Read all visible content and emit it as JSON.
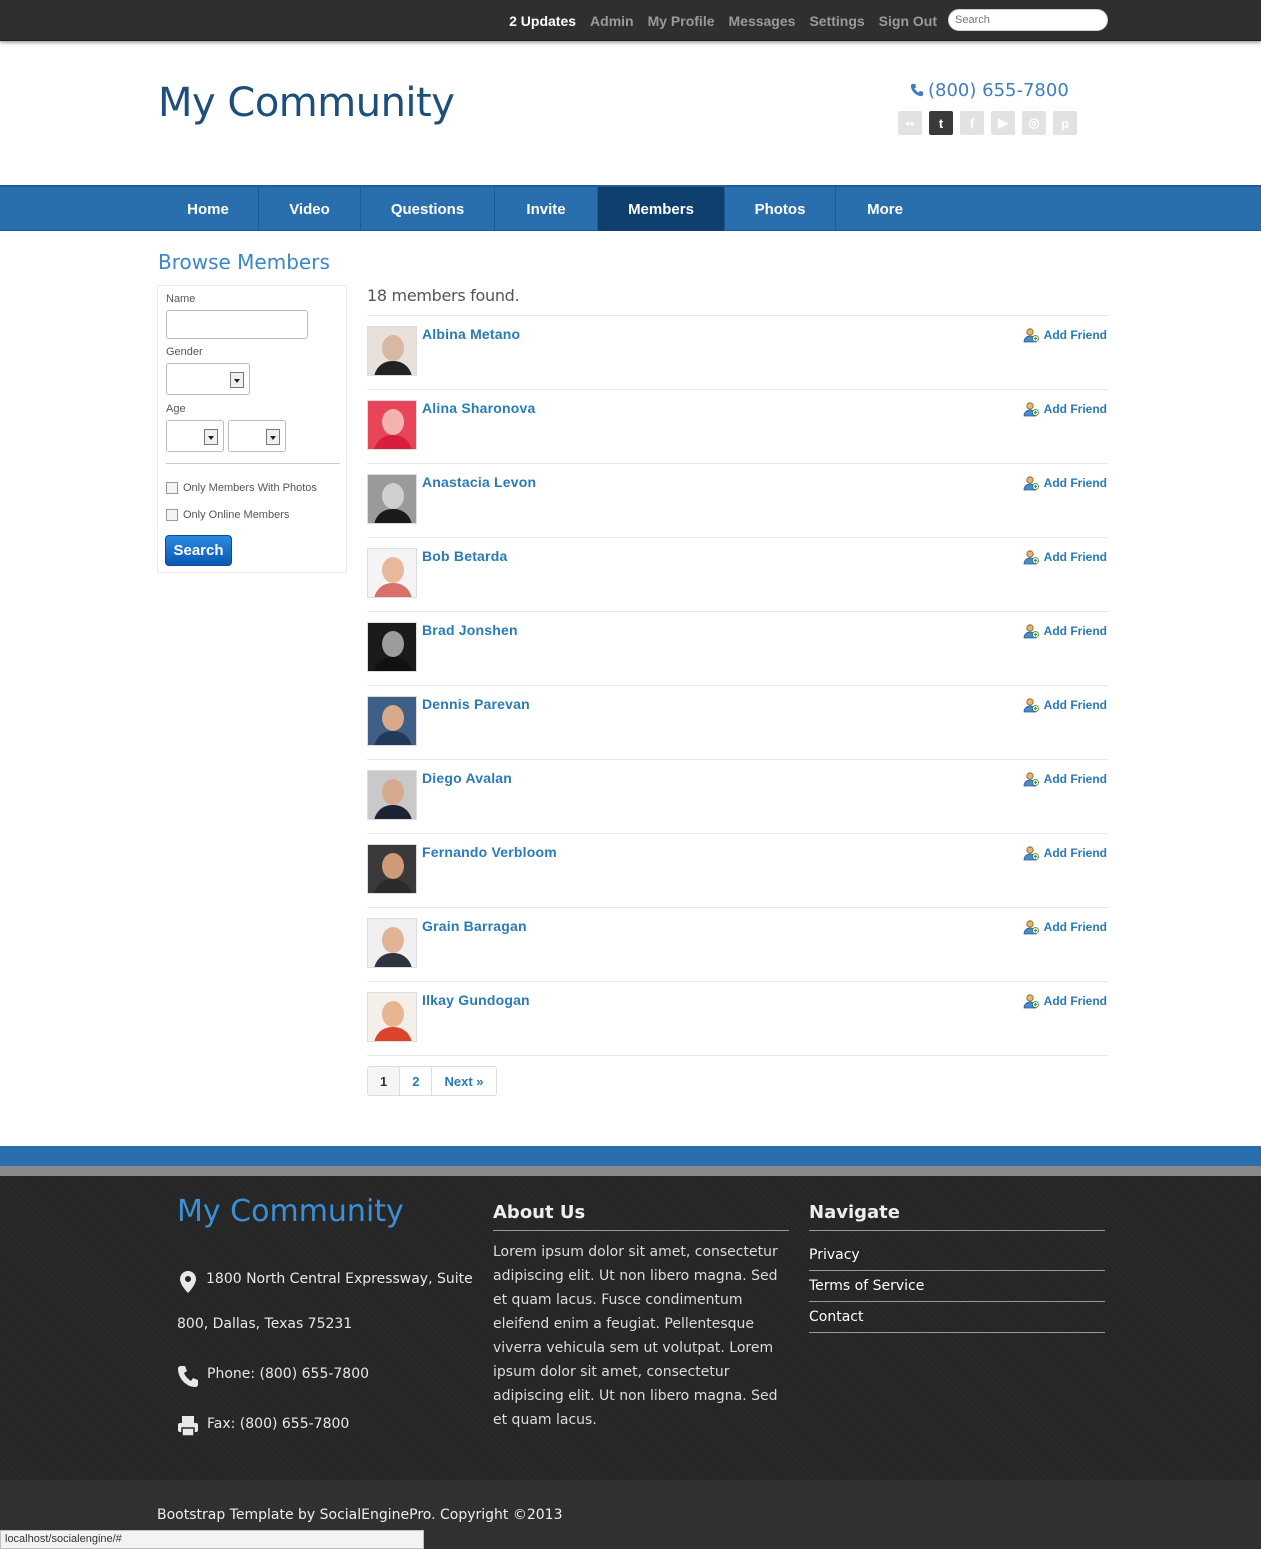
{
  "topbar": {
    "links": [
      {
        "label": "2 Updates",
        "strong": true
      },
      {
        "label": "Admin"
      },
      {
        "label": "My Profile"
      },
      {
        "label": "Messages"
      },
      {
        "label": "Settings"
      },
      {
        "label": "Sign Out"
      }
    ],
    "search_placeholder": "Search"
  },
  "header": {
    "title": "My Community",
    "phone": "(800) 655-7800",
    "socials": [
      "flickr-icon",
      "twitter-icon",
      "facebook-icon",
      "youtube-icon",
      "dribbble-icon",
      "pinterest-icon"
    ]
  },
  "nav": {
    "items": [
      {
        "label": "Home"
      },
      {
        "label": "Video"
      },
      {
        "label": "Questions"
      },
      {
        "label": "Invite"
      },
      {
        "label": "Members",
        "active": true
      },
      {
        "label": "Photos"
      },
      {
        "label": "More"
      }
    ]
  },
  "browse": {
    "title": "Browse Members",
    "filter": {
      "name_label": "Name",
      "gender_label": "Gender",
      "age_label": "Age",
      "photos_label": "Only Members With Photos",
      "online_label": "Only Online Members",
      "search_button": "Search"
    },
    "found": "18 members found.",
    "add_label": "Add Friend",
    "members": [
      {
        "name": "Albina Metano",
        "skin": "#d9b8a3",
        "cloth": "#222222",
        "bg": "#e8e0da"
      },
      {
        "name": "Alina Sharonova",
        "skin": "#f2b3b0",
        "cloth": "#d81e3c",
        "bg": "#e8455a"
      },
      {
        "name": "Anastacia Levon",
        "skin": "#cfcfcf",
        "cloth": "#1a1a1a",
        "bg": "#9a9a9a"
      },
      {
        "name": "Bob Betarda",
        "skin": "#e7b99a",
        "cloth": "#d9716a",
        "bg": "#f4f4f4"
      },
      {
        "name": "Brad Jonshen",
        "skin": "#9c9c9c",
        "cloth": "#111111",
        "bg": "#1a1a1a"
      },
      {
        "name": "Dennis Parevan",
        "skin": "#d8a98a",
        "cloth": "#223a5a",
        "bg": "#3f5f87"
      },
      {
        "name": "Diego Avalan",
        "skin": "#d7a98e",
        "cloth": "#1c2433",
        "bg": "#c9c9c9"
      },
      {
        "name": "Fernando Verbloom",
        "skin": "#cf9a77",
        "cloth": "#2b2b2b",
        "bg": "#3a3a3a"
      },
      {
        "name": "Grain Barragan",
        "skin": "#e2b497",
        "cloth": "#2e3440",
        "bg": "#f0f0f0"
      },
      {
        "name": "Ilkay Gundogan",
        "skin": "#e7b590",
        "cloth": "#d9442b",
        "bg": "#f3efe9"
      }
    ],
    "pagination": [
      {
        "label": "1",
        "current": true
      },
      {
        "label": "2"
      },
      {
        "label": "Next »"
      }
    ]
  },
  "footer": {
    "title": "My Community",
    "address_line1": "1800 North Central Expressway, Suite",
    "address_line2": "800, Dallas, Texas 75231",
    "phone": "Phone: (800) 655-7800",
    "fax": "Fax: (800) 655-7800",
    "about_heading": "About Us",
    "about_text": "Lorem ipsum dolor sit amet, consectetur adipiscing elit. Ut non libero magna. Sed et quam lacus. Fusce condimentum eleifend enim a feugiat. Pellentesque viverra vehicula sem ut volutpat. Lorem ipsum dolor sit amet, consectetur adipiscing elit. Ut non libero magna. Sed et quam lacus.",
    "navigate_heading": "Navigate",
    "navigate_links": [
      "Privacy",
      "Terms of Service",
      "Contact"
    ],
    "copyright": "Bootstrap Template by SocialEnginePro. Copyright ©2013"
  },
  "statusbar": {
    "url": "localhost/socialengine/#"
  },
  "colors": {
    "accent": "#2a6fad",
    "link": "#2a7ab8",
    "nav_active": "#0f3f6e",
    "footer_bg": "#262626"
  }
}
